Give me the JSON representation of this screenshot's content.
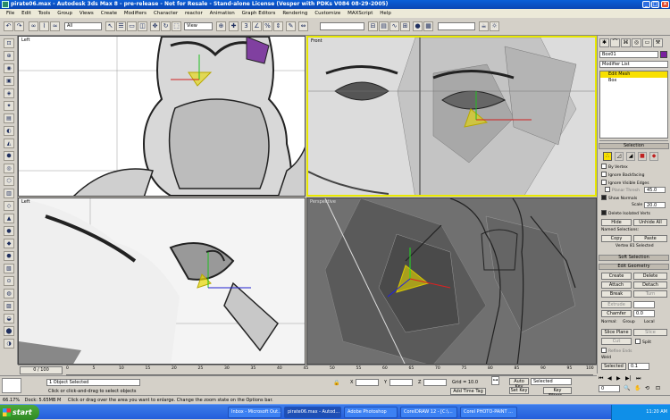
{
  "window": {
    "title": "pirate06.max - Autodesk 3ds Max 8 - pre-release - Not for Resale - Stand-alone License (Vesper with PDKs V084 08-29-2005)",
    "controls": [
      "_",
      "□",
      "×"
    ]
  },
  "menu": [
    "File",
    "Edit",
    "Tools",
    "Group",
    "Views",
    "Create",
    "Modifiers",
    "Character",
    "reactor",
    "Animation",
    "Graph Editors",
    "Rendering",
    "Customize",
    "MAXScript",
    "Help"
  ],
  "toolbar": {
    "selection_filter": "All",
    "reference_coord": "View"
  },
  "viewports": {
    "top_left": {
      "label": "Left"
    },
    "top_right": {
      "label": "Front"
    },
    "bottom_left": {
      "label": "Left"
    },
    "bottom_right": {
      "label": "Perspective"
    }
  },
  "command_panel": {
    "object_name": "Box01",
    "object_color": "#7a1fa0",
    "modifier_list": "Modifier List",
    "stack": [
      {
        "label": "Edit Mesh",
        "selected": true
      },
      {
        "label": "Box",
        "selected": false
      }
    ],
    "selection_rollout": "Selection",
    "by_vertex": "By Vertex",
    "ignore_backfacing": "Ignore Backfacing",
    "ignore_visible_edges": "Ignore Visible Edges",
    "planar_thresh_label": "Planar Thresh",
    "planar_thresh_value": "45.0",
    "show_normals": "Show Normals",
    "scale_label": "Scale",
    "scale_value": "20.0",
    "delete_isolated": "Delete Isolated Verts",
    "hide": "Hide",
    "unhide_all": "Unhide All",
    "named_selections": "Named Selections:",
    "copy": "Copy",
    "paste": "Paste",
    "selected_info": "Vertex 81 Selected",
    "soft_selection": "Soft Selection",
    "edit_geometry": "Edit Geometry",
    "create": "Create",
    "delete": "Delete",
    "attach": "Attach",
    "detach": "Detach",
    "break": "Break",
    "turn": "Turn",
    "extrude": "Extrude",
    "chamfer": "Chamfer",
    "chamfer_value": "0.0",
    "normal_label": "Normal:",
    "group": "Group",
    "local": "Local",
    "slice_plane": "Slice Plane",
    "slice": "Slice",
    "cut": "Cut",
    "split": "Split",
    "refine_ends": "Refine Ends",
    "weld": "Weld",
    "weld_selected": "Selected",
    "weld_value": "0.1"
  },
  "timeline": {
    "frame": "0 / 100",
    "ticks": [
      "0",
      "5",
      "10",
      "15",
      "20",
      "25",
      "30",
      "35",
      "40",
      "45",
      "50",
      "55",
      "60",
      "65",
      "70",
      "75",
      "80",
      "85",
      "90",
      "95",
      "100"
    ]
  },
  "status": {
    "objects_selected": "1 Object Selected",
    "hint": "Click or click-and-drag to select objects",
    "x_label": "X",
    "y_label": "Y",
    "z_label": "Z",
    "grid": "Grid = 10.0",
    "add_time_tag": "Add Time Tag",
    "auto_key": "Auto Key",
    "selected": "Selected",
    "set_key": "Set Key",
    "key_filters": "Key Filters...",
    "frame_field": "0",
    "script_listener": "Dock: 5.65MB  M",
    "zoom": "66.17%"
  },
  "prompt": "Click or drag over the area you want to enlarge. Change the zoom state on the Options bar.",
  "taskbar": {
    "start": "start",
    "tasks": [
      "Inbox - Microsoft Out...",
      "pirate06.max - Autod...",
      "Adobe Photoshop",
      "CorelDRAW 12 - [C:\\...",
      "Corel PHOTO-PAINT ..."
    ],
    "clock": "11:20 AM"
  },
  "colors": {
    "accent": "#0a5fd8",
    "active_viewport": "#e8e800",
    "gizmo": "#e8d800"
  }
}
